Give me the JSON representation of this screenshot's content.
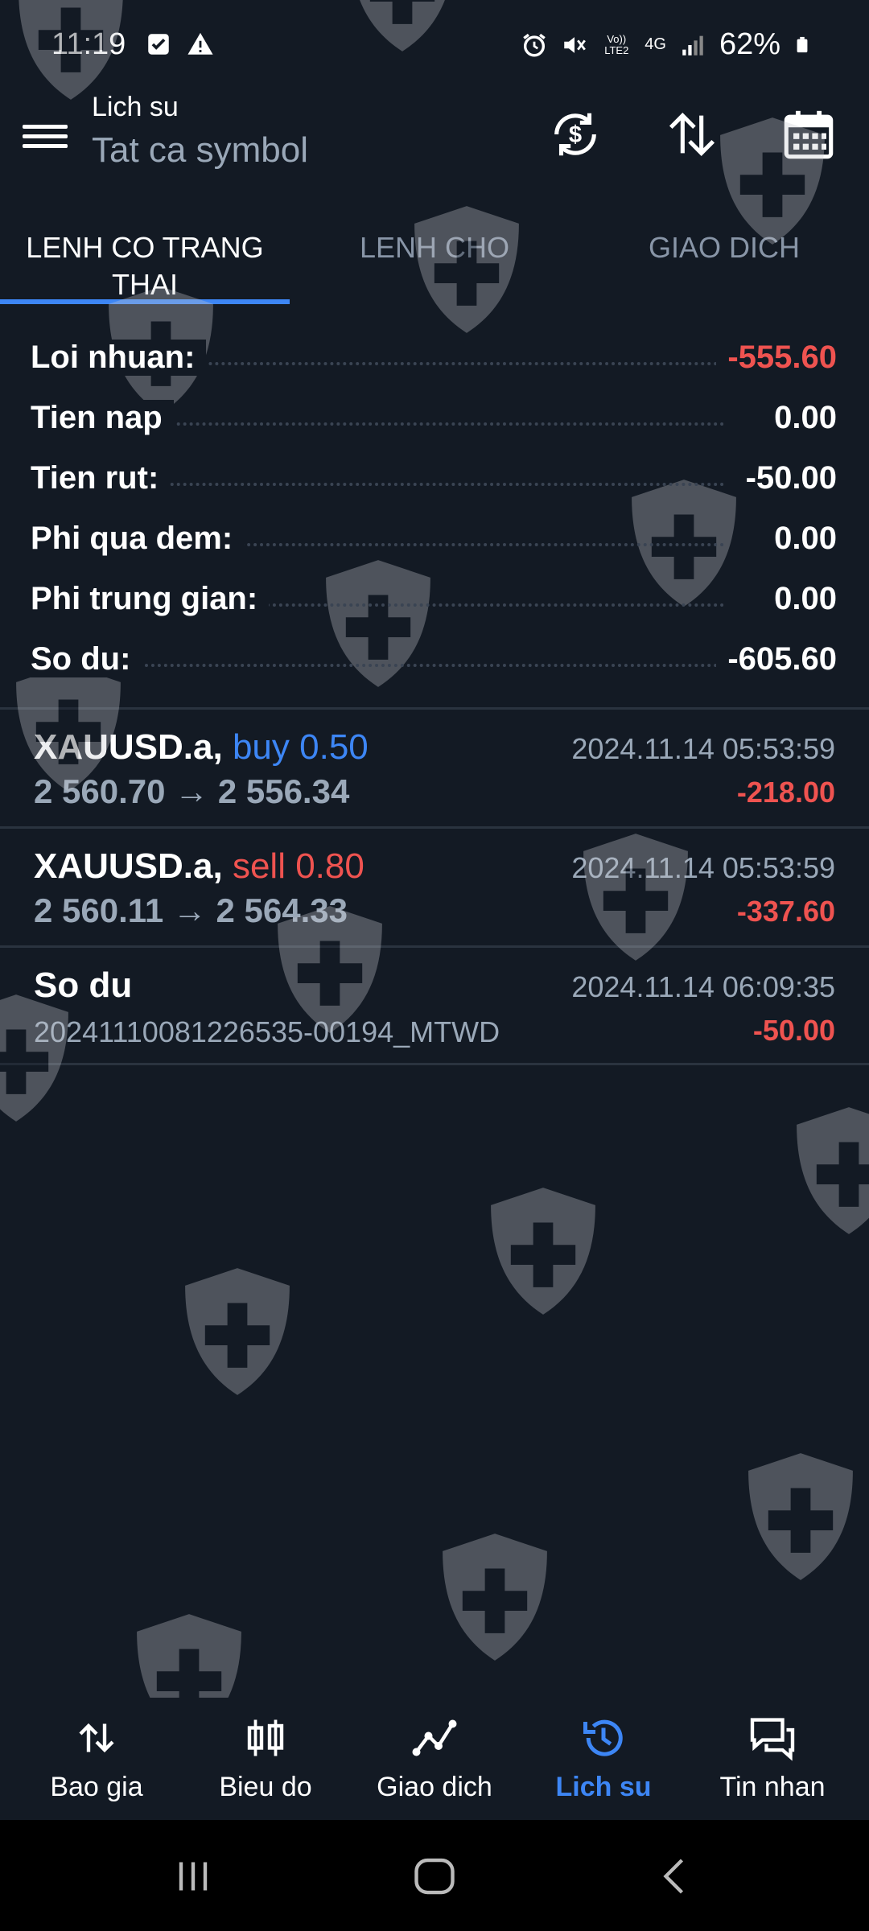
{
  "status_bar": {
    "time": "11:19",
    "battery": "62%",
    "network": "4G",
    "volte": "Vo)) LTE2",
    "icons": [
      "checkbox-icon",
      "warning-icon",
      "alarm-icon",
      "mute-icon",
      "signal-icon",
      "battery-icon"
    ]
  },
  "app_bar": {
    "title": "Lich su",
    "subtitle": "Tat ca symbol",
    "actions": [
      "currency-exchange-icon",
      "sort-icon",
      "calendar-icon"
    ]
  },
  "tabs": [
    {
      "label": "LENH CO TRANG THAI",
      "active": true
    },
    {
      "label": "LENH CHO",
      "active": false
    },
    {
      "label": "GIAO DICH",
      "active": false
    }
  ],
  "summary": [
    {
      "label": "Loi nhuan:",
      "value": "-555.60"
    },
    {
      "label": "Tien nap",
      "value": "0.00"
    },
    {
      "label": "Tien rut:",
      "value": "-50.00"
    },
    {
      "label": "Phi qua dem:",
      "value": "0.00"
    },
    {
      "label": "Phi trung gian:",
      "value": "0.00"
    },
    {
      "label": "So du:",
      "value": "-605.60"
    }
  ],
  "transactions": [
    {
      "symbol": "XAUUSD.a,",
      "side": "buy 0.50",
      "prices": "2 560.70 → 2 556.34",
      "time": "2024.11.14 05:53:59",
      "profit": "-218.00"
    },
    {
      "symbol": "XAUUSD.a,",
      "side": "sell 0.80",
      "prices": "2 560.11 → 2 564.33",
      "time": "2024.11.14 05:53:59",
      "profit": "-337.60"
    },
    {
      "symbol": "So du",
      "comment": "20241110081226535-00194_MTWD",
      "time": "2024.11.14 06:09:35",
      "profit": "-50.00"
    }
  ],
  "bottom_nav": [
    {
      "label": "Bao gia",
      "icon": "quotes-arrows-icon"
    },
    {
      "label": "Bieu do",
      "icon": "candlestick-icon"
    },
    {
      "label": "Giao dich",
      "icon": "trade-line-icon"
    },
    {
      "label": "Lich su",
      "icon": "history-icon",
      "active": true
    },
    {
      "label": "Tin nhan",
      "icon": "messages-icon"
    }
  ],
  "colors": {
    "background": "#131a24",
    "accent": "#3d86f5",
    "negative": "#ef5350",
    "muted": "#9aa8b8"
  }
}
